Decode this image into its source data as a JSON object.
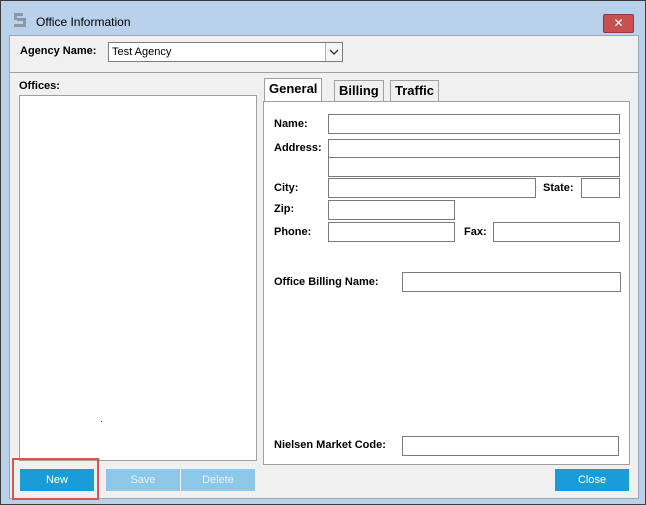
{
  "window": {
    "title": "Office Information",
    "close_glyph": "✕"
  },
  "agency": {
    "label": "Agency Name:",
    "selected": "Test Agency"
  },
  "offices": {
    "label": "Offices:"
  },
  "tabs": [
    {
      "label": "General",
      "active": true
    },
    {
      "label": "Billing",
      "active": false
    },
    {
      "label": "Traffic",
      "active": false
    }
  ],
  "general": {
    "name_label": "Name:",
    "address_label": "Address:",
    "city_label": "City:",
    "state_label": "State:",
    "zip_label": "Zip:",
    "phone_label": "Phone:",
    "fax_label": "Fax:",
    "office_billing_name_label": "Office Billing Name:",
    "nielsen_market_code_label": "Nielsen Market Code:"
  },
  "buttons": {
    "new": "New",
    "save": "Save",
    "delete": "Delete",
    "close": "Close"
  },
  "colors": {
    "accent": "#1a9cd8",
    "disabled": "#8cc8e8",
    "highlight": "#d9534f",
    "titlebar": "#b9d1ea"
  }
}
